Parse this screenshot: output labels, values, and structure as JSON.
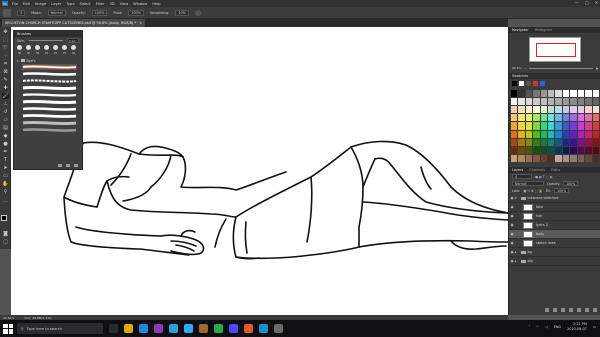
{
  "app": {
    "logo_text": "Ps",
    "menus": [
      "File",
      "Edit",
      "Image",
      "Layer",
      "Type",
      "Select",
      "Filter",
      "3D",
      "View",
      "Window",
      "Help"
    ],
    "window_controls": [
      "—",
      "□",
      "✕"
    ]
  },
  "options": {
    "mode_label": "Mode:",
    "mode_value": "Normal",
    "opacity_label": "Opacity:",
    "opacity_value": "100%",
    "flow_label": "Flow:",
    "flow_value": "100%",
    "smoothing_label": "Smoothing:",
    "smoothing_value": "10%",
    "brush_size": "3"
  },
  "document": {
    "tab_title": "SEGUETON CHURCH STAMTGIPP CUTSCENE0.psd @ 90.6% (body, RGB/8) *",
    "close_glyph": "×"
  },
  "brushes": {
    "title": "Brushes",
    "size_label": "Size:",
    "size_value": "3 px",
    "tip_numbers": [
      "30",
      "30",
      "30",
      "25",
      "25",
      "25",
      "36"
    ],
    "folder_label": "Kyle's",
    "selected_index": 0
  },
  "navigator": {
    "tabs": [
      "Navigator",
      "Histogram"
    ],
    "zoom": "90.6%"
  },
  "swatches": {
    "title": "Swatches",
    "colors": [
      "#000000",
      "#333333",
      "#555555",
      "#777777",
      "#999999",
      "#bbbbbb",
      "#dddddd",
      "#ffffff",
      "#ffffff",
      "#ffffff",
      "#ffffff",
      "#ffffff",
      "#f2f2f2",
      "#e6e6e6",
      "#d9d9d9",
      "#cccccc",
      "#bfbfbf",
      "#b3b3b3",
      "#a6a6a6",
      "#999999",
      "#8c8c8c",
      "#808080",
      "#737373",
      "#666666",
      "#e8d0b0",
      "#f0e0c0",
      "#f8f0d0",
      "#ffffe0",
      "#e0f0d0",
      "#c0e0d0",
      "#c0d8e8",
      "#c8c8f0",
      "#e0c8f0",
      "#f0c8e0",
      "#f8d0d0",
      "#f8e0d0",
      "#f4c77a",
      "#f7e26b",
      "#e8f06b",
      "#a6e26b",
      "#6be29a",
      "#6be2d4",
      "#6bb8e2",
      "#6b84e2",
      "#9a6be2",
      "#d46be2",
      "#e26bb0",
      "#e26b6b",
      "#f2a23a",
      "#f2d13a",
      "#d6e23a",
      "#7ad63a",
      "#3ad67a",
      "#3ad6c8",
      "#3a9ad6",
      "#3a5ad6",
      "#7a3ad6",
      "#c83ad6",
      "#d63a8c",
      "#d63a3a",
      "#e07020",
      "#e0b020",
      "#b8c820",
      "#50b820",
      "#20b860",
      "#20b8b0",
      "#2080c8",
      "#2040c0",
      "#6020c0",
      "#b020b8",
      "#c82070",
      "#c82020",
      "#a84a10",
      "#a87a10",
      "#7a9010",
      "#308010",
      "#108040",
      "#108078",
      "#105890",
      "#102890",
      "#401090",
      "#801088",
      "#901050",
      "#901010",
      "#6a2e08",
      "#6a4c08",
      "#4a5a08",
      "#1e5008",
      "#08502a",
      "#08504c",
      "#08385a",
      "#08185a",
      "#28085a",
      "#50085a",
      "#5a0832",
      "#5a0808",
      "#c8a070",
      "#b08860",
      "#987050",
      "#805840",
      "#684030",
      "#503020",
      "#c0a8a0",
      "#a89088",
      "#907870",
      "#786058",
      "#604840",
      "#483028"
    ]
  },
  "layers": {
    "tabs": [
      "Layers",
      "Channels",
      "Paths"
    ],
    "blend_mode": "Normal",
    "opacity_label": "Opacity:",
    "opacity_value": "100%",
    "lock_label": "Lock:",
    "fill_label": "Fill:",
    "fill_value": "100%",
    "rows": [
      {
        "name": "cutscene sketched",
        "type": "folder",
        "selected": false
      },
      {
        "name": "face",
        "type": "layer",
        "selected": false
      },
      {
        "name": "hair",
        "type": "layer",
        "selected": false
      },
      {
        "name": "lyrics 2",
        "type": "layer",
        "selected": false
      },
      {
        "name": "body",
        "type": "layer",
        "selected": true
      },
      {
        "name": "sketch lines",
        "type": "layer",
        "selected": false
      },
      {
        "name": "bg",
        "type": "folder",
        "selected": false
      },
      {
        "name": "sky",
        "type": "folder",
        "selected": false
      }
    ]
  },
  "status": {
    "zoom": "90.61%",
    "doc_info": "Doc: 48.8M/1.31G"
  },
  "taskbar": {
    "search_placeholder": "Type here to search",
    "apps": [
      "#2a2a2a",
      "#e0a800",
      "#1e88e5",
      "#8e3ab8",
      "#2aa1d8",
      "#31a8ff",
      "#9a6b2a",
      "#2ea84a",
      "#4a4aff",
      "#e05a2a",
      "#1a90c8",
      "#6a6a6a"
    ],
    "lang": "ENG",
    "time": "2:21 PM",
    "date": "2020-08-07"
  }
}
